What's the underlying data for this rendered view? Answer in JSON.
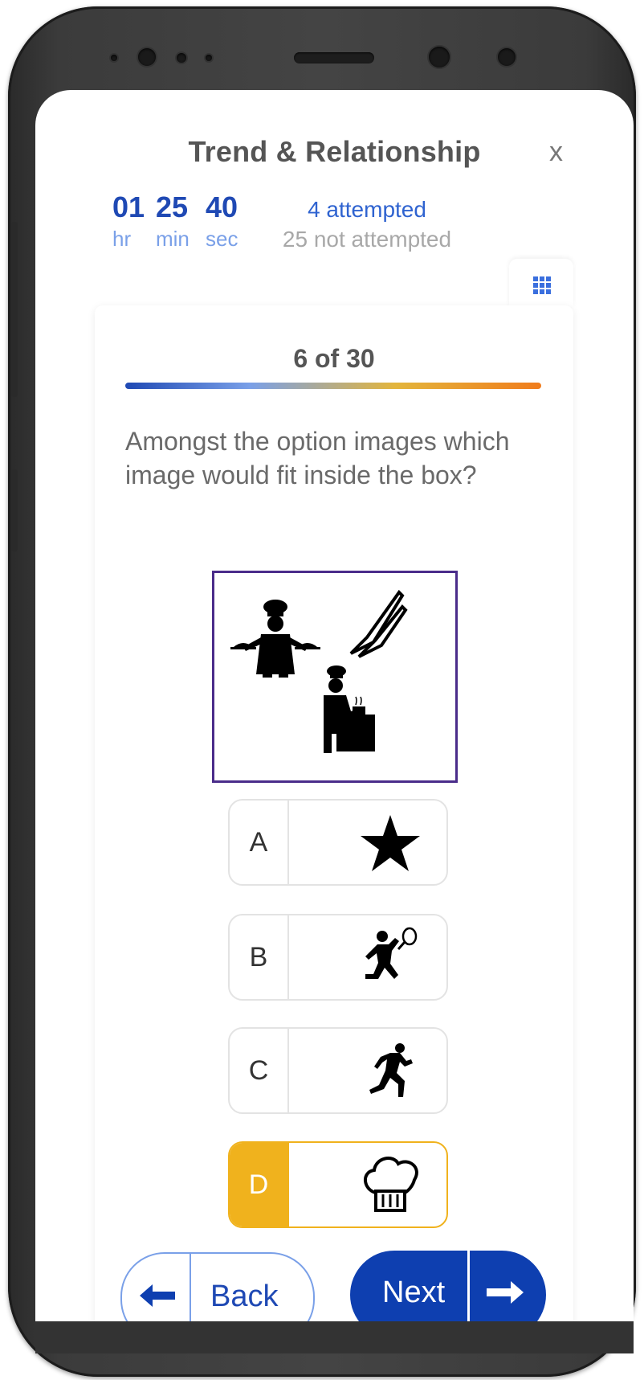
{
  "header": {
    "title": "Trend & Relationship",
    "close_label": "x"
  },
  "timer": {
    "hours": "01",
    "hours_unit": "hr",
    "minutes": "25",
    "minutes_unit": "min",
    "seconds": "40",
    "seconds_unit": "sec"
  },
  "stats": {
    "attempted": "4 attempted",
    "not_attempted": "25 not attempted"
  },
  "question": {
    "counter": "6 of 30",
    "progress": 0.2,
    "text": "Amongst the option images which image would fit inside the box?",
    "box_icons": [
      "chef-serving-icon",
      "knives-icon",
      "chef-cooking-icon"
    ]
  },
  "options": [
    {
      "letter": "A",
      "icon": "star-icon",
      "selected": false
    },
    {
      "letter": "B",
      "icon": "tennis-player-icon",
      "selected": false
    },
    {
      "letter": "C",
      "icon": "runner-icon",
      "selected": false
    },
    {
      "letter": "D",
      "icon": "chef-hat-icon",
      "selected": true
    }
  ],
  "nav": {
    "back_label": "Back",
    "next_label": "Next"
  },
  "colors": {
    "primary": "#0e3fb0",
    "accent": "#f0b21d",
    "question_border": "#4a2c8a"
  }
}
